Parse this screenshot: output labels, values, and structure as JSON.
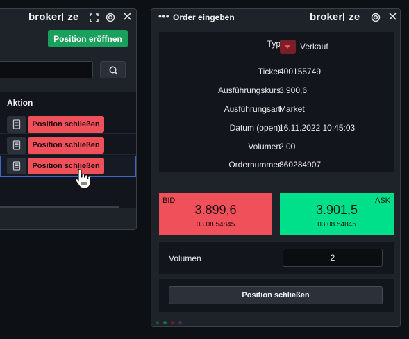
{
  "brand": {
    "name_prefix": "broker",
    "name_suffix": "ze"
  },
  "left_window": {
    "open_position_label": "Position eröffnen",
    "search": {
      "value": "",
      "placeholder": ""
    },
    "table": {
      "header": "Aktion",
      "rows": [
        {
          "action_label": "Position schließen"
        },
        {
          "action_label": "Position schließen"
        },
        {
          "action_label": "Position schließen"
        }
      ]
    }
  },
  "order_window": {
    "title": "Order eingeben",
    "fields": [
      {
        "label": "Typ",
        "value": "Verkauf"
      },
      {
        "label": "Ticker",
        "value": "400155749"
      },
      {
        "label": "Ausführungskurs",
        "value": "3.900,6"
      },
      {
        "label": "Ausführungsart",
        "value": "Market"
      },
      {
        "label": "Datum (open)",
        "value": "16.11.2022 10:45:03"
      },
      {
        "label": "Volumen",
        "value": "2,00"
      },
      {
        "label": "Ordernummer",
        "value": "860284907"
      }
    ],
    "bid": {
      "label": "BID",
      "price": "3.899,6",
      "time": "03.08.54845",
      "color": "#f0505a"
    },
    "ask": {
      "label": "ASK",
      "price": "3.901,5",
      "time": "03.08.54845",
      "color": "#00e08a"
    },
    "volume": {
      "label": "Volumen",
      "value": "2"
    },
    "submit_label": "Position schließen"
  },
  "icons": {
    "expand": "expand-icon",
    "target": "target-icon",
    "close": "close-icon",
    "search": "search-icon",
    "document": "document-icon",
    "menu": "more-dots-icon",
    "sell_type": "chevron-down-icon"
  },
  "colors": {
    "accent_green": "#18a05c",
    "sell_red": "#f0505a",
    "buy_green": "#00e08a",
    "selection_blue": "#3d67c9"
  }
}
